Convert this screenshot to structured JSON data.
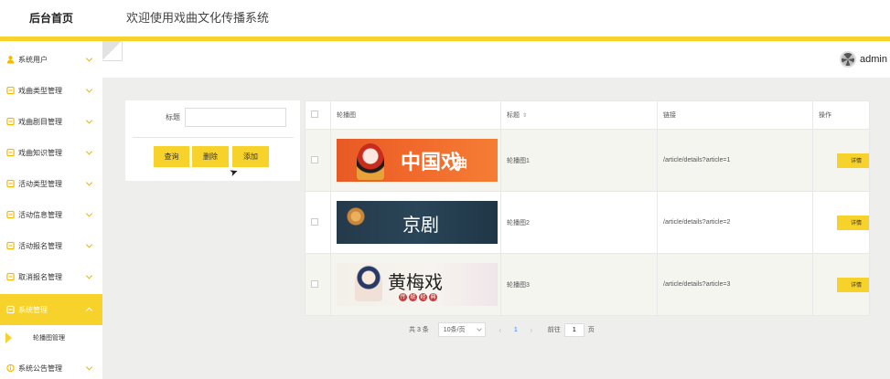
{
  "header": {
    "brand": "后台首页",
    "welcome": "欢迎使用戏曲文化传播系统",
    "username": "admin"
  },
  "sidebar": {
    "items": [
      {
        "label": "系统用户",
        "icon": "user-icon"
      },
      {
        "label": "戏曲类型管理",
        "icon": "doc-icon"
      },
      {
        "label": "戏曲剧目管理",
        "icon": "doc-icon"
      },
      {
        "label": "戏曲知识管理",
        "icon": "doc-icon"
      },
      {
        "label": "活动类型管理",
        "icon": "doc-icon"
      },
      {
        "label": "活动信息管理",
        "icon": "doc-icon"
      },
      {
        "label": "活动报名管理",
        "icon": "doc-icon"
      },
      {
        "label": "取消报名管理",
        "icon": "doc-icon"
      },
      {
        "label": "系统管理",
        "icon": "doc-icon",
        "active": true
      },
      {
        "label": "系统公告管理",
        "icon": "info-icon"
      }
    ],
    "sub_item": "轮播图管理"
  },
  "search": {
    "title_label": "标题",
    "title_value": "",
    "buttons": {
      "search": "查询",
      "delete": "删除",
      "add": "添加"
    }
  },
  "table": {
    "headers": {
      "image": "轮播图",
      "title": "标题",
      "link": "链接",
      "action": "操作"
    },
    "rows": [
      {
        "title": "轮播图1",
        "link": "/article/details?article=1",
        "detail": "详情",
        "banner_text": "中国戏",
        "banner_text2": "曲"
      },
      {
        "title": "轮播图2",
        "link": "/article/details?article=2",
        "detail": "详情",
        "banner_text": "京剧"
      },
      {
        "title": "轮播图3",
        "link": "/article/details?article=3",
        "detail": "详情",
        "banner_text": "黄梅戏",
        "banner_chars": [
          "传",
          "统",
          "经",
          "典"
        ]
      }
    ]
  },
  "pager": {
    "total": "共 3 条",
    "page_size": "10条/页",
    "prev": "‹",
    "current": "1",
    "next": "›",
    "goto_label": "前往",
    "goto_value": "1",
    "goto_suffix": "页"
  },
  "colors": {
    "accent": "#f6d22b",
    "link": "#1890ff"
  }
}
